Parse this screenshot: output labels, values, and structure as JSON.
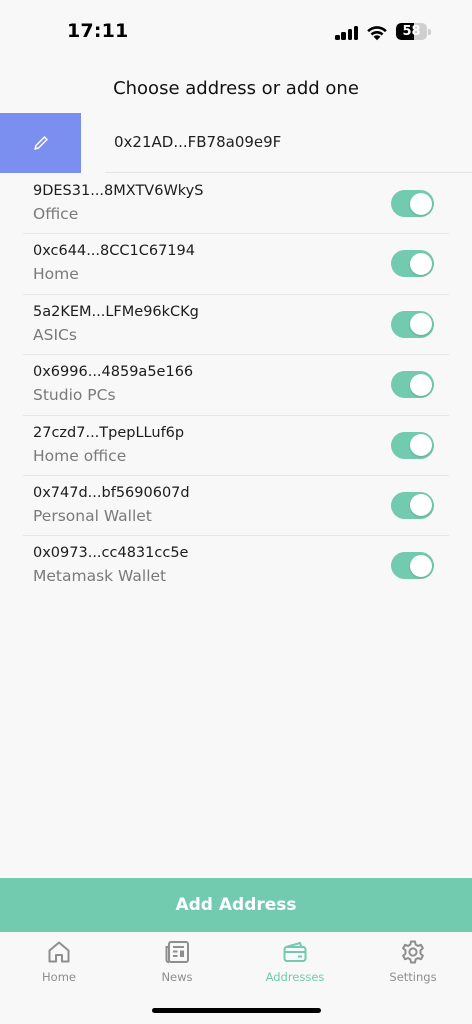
{
  "status_bar": {
    "time": "17:11",
    "battery_level": "58",
    "battery_fraction": 0.58
  },
  "header": {
    "title": "Choose address or add one"
  },
  "current": {
    "edit_icon": "pencil-icon",
    "address": "0x21AD...FB78a09e9F"
  },
  "addresses": [
    {
      "address": "9DES31...8MXTV6WkyS",
      "label": "Office",
      "enabled": true
    },
    {
      "address": "0xc644...8CC1C67194",
      "label": "Home",
      "enabled": true
    },
    {
      "address": "5a2KEM...LFMe96kCKg",
      "label": "ASICs",
      "enabled": true
    },
    {
      "address": "0x6996...4859a5e166",
      "label": "Studio PCs",
      "enabled": true
    },
    {
      "address": "27czd7...TpepLLuf6p",
      "label": "Home office",
      "enabled": true
    },
    {
      "address": "0x747d...bf5690607d",
      "label": "Personal Wallet",
      "enabled": true
    },
    {
      "address": "0x0973...cc4831cc5e",
      "label": "Metamask Wallet",
      "enabled": true
    }
  ],
  "actions": {
    "add_address_label": "Add Address"
  },
  "tabs": [
    {
      "label": "Home",
      "icon": "home-icon",
      "active": false
    },
    {
      "label": "News",
      "icon": "newspaper-icon",
      "active": false
    },
    {
      "label": "Addresses",
      "icon": "wallet-icon",
      "active": true
    },
    {
      "label": "Settings",
      "icon": "gear-icon",
      "active": false
    }
  ],
  "colors": {
    "accent": "#72caaf",
    "edit_button": "#7b8ff1",
    "inactive_tab": "#8e8e8e"
  }
}
